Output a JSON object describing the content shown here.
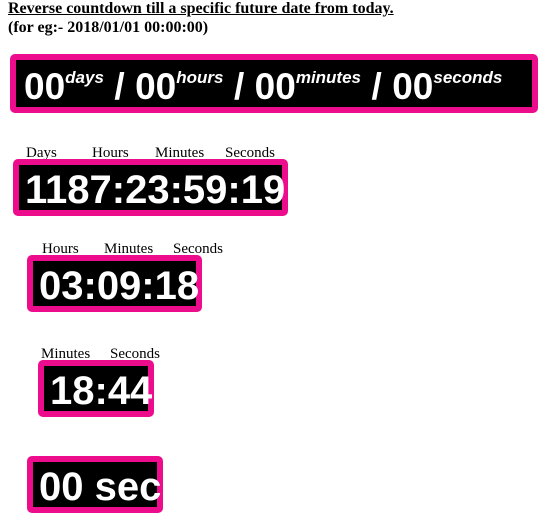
{
  "header": {
    "title": "Reverse countdown till a specific future date from today.",
    "subtitle": "(for eg:- 2018/01/01 00:00:00)"
  },
  "accent_color": "#ec0c8c",
  "countdown_full": {
    "days": "00",
    "days_unit": "days",
    "hours": "00",
    "hours_unit": "hours",
    "minutes": "00",
    "minutes_unit": "minutes",
    "seconds": "00",
    "seconds_unit": "seconds",
    "separator": "/"
  },
  "countdown_dhms": {
    "labels": [
      "Days",
      "Hours",
      "Minutes",
      "Seconds"
    ],
    "value": "1187:23:59:19"
  },
  "countdown_hms": {
    "labels": [
      "Hours",
      "Minutes",
      "Seconds"
    ],
    "value": "03:09:18"
  },
  "countdown_ms": {
    "labels": [
      "Minutes",
      "Seconds"
    ],
    "value": "18:44"
  },
  "countdown_s": {
    "value": "00 sec"
  }
}
